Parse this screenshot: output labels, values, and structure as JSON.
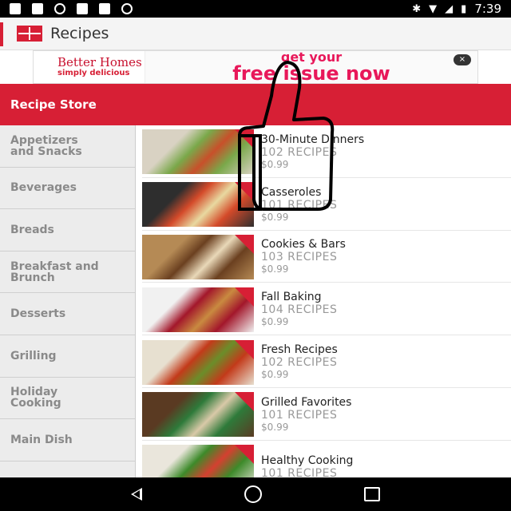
{
  "status_bar": {
    "time": "7:39",
    "icons_left": [
      "facebook-icon",
      "image-icon",
      "settings-icon",
      "lock-icon",
      "tag-icon",
      "android-icon"
    ],
    "icons_right": [
      "bluetooth-icon",
      "wifi-icon",
      "signal-icon",
      "battery-icon"
    ]
  },
  "app_bar": {
    "title": "Recipes",
    "accent": "#d71f35"
  },
  "ad": {
    "magazine_line1": "Better Homes",
    "magazine_line2": "simply delicious",
    "headline_top": "get your",
    "headline_main": "free issue now",
    "close_label": "×"
  },
  "store": {
    "header": "Recipe Store"
  },
  "sidebar": {
    "items": [
      {
        "label": "Appetizers\nand Snacks"
      },
      {
        "label": "Beverages"
      },
      {
        "label": "Breads"
      },
      {
        "label": "Breakfast and\nBrunch"
      },
      {
        "label": "Desserts"
      },
      {
        "label": "Grilling"
      },
      {
        "label": "Holiday\nCooking"
      },
      {
        "label": "Main Dish"
      },
      {
        "label": ""
      }
    ]
  },
  "recipes": [
    {
      "name": "30-Minute Dinners",
      "count": "102 RECIPES",
      "price": "$0.99",
      "colors": [
        "#d9d2c3",
        "#7aa84a",
        "#c8502a"
      ]
    },
    {
      "name": "Casseroles",
      "count": "101 RECIPES",
      "price": "$0.99",
      "colors": [
        "#2e2e2e",
        "#d44a2a",
        "#e8d9a0"
      ]
    },
    {
      "name": "Cookies & Bars",
      "count": "103 RECIPES",
      "price": "$0.99",
      "colors": [
        "#b58a55",
        "#6b4020",
        "#e9d8b8"
      ]
    },
    {
      "name": "Fall Baking",
      "count": "104 RECIPES",
      "price": "$0.99",
      "colors": [
        "#f1f1f1",
        "#a3172b",
        "#c98a40"
      ]
    },
    {
      "name": "Fresh Recipes",
      "count": "102 RECIPES",
      "price": "$0.99",
      "colors": [
        "#e7e0d0",
        "#c33a1a",
        "#6b8e2a"
      ]
    },
    {
      "name": "Grilled Favorites",
      "count": "101 RECIPES",
      "price": "$0.99",
      "colors": [
        "#5a3a22",
        "#2e7a3a",
        "#d9c9a8"
      ]
    },
    {
      "name": "Healthy Cooking",
      "count": "101 RECIPES",
      "price": "",
      "colors": [
        "#eae6dc",
        "#3d8a2a",
        "#d44030"
      ]
    }
  ],
  "nav": {
    "icons": [
      "back-icon",
      "home-icon",
      "recent-apps-icon"
    ]
  }
}
